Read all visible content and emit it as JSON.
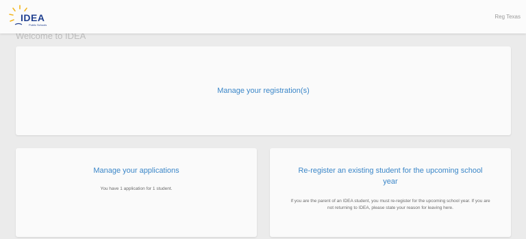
{
  "header": {
    "logo_text": "IDEA",
    "logo_sub": "Public Schools",
    "region": "Reg Texas"
  },
  "page": {
    "welcome": "Welcome to IDEA"
  },
  "cards": {
    "registration": {
      "title": "Manage your registration(s)"
    },
    "applications": {
      "title": "Manage your applications",
      "body": "You have 1 application for 1 student."
    },
    "reregister": {
      "title": "Re-register an existing student for the upcoming school year",
      "body": "If you are the parent of an IDEA student, you must re-register for the upcoming school year. If you are not returning to IDEA, please state your reason for leaving here."
    }
  },
  "colors": {
    "brand_blue": "#1f3f8f",
    "sun_yellow": "#f2b51c",
    "link_blue": "#3a86c8"
  }
}
